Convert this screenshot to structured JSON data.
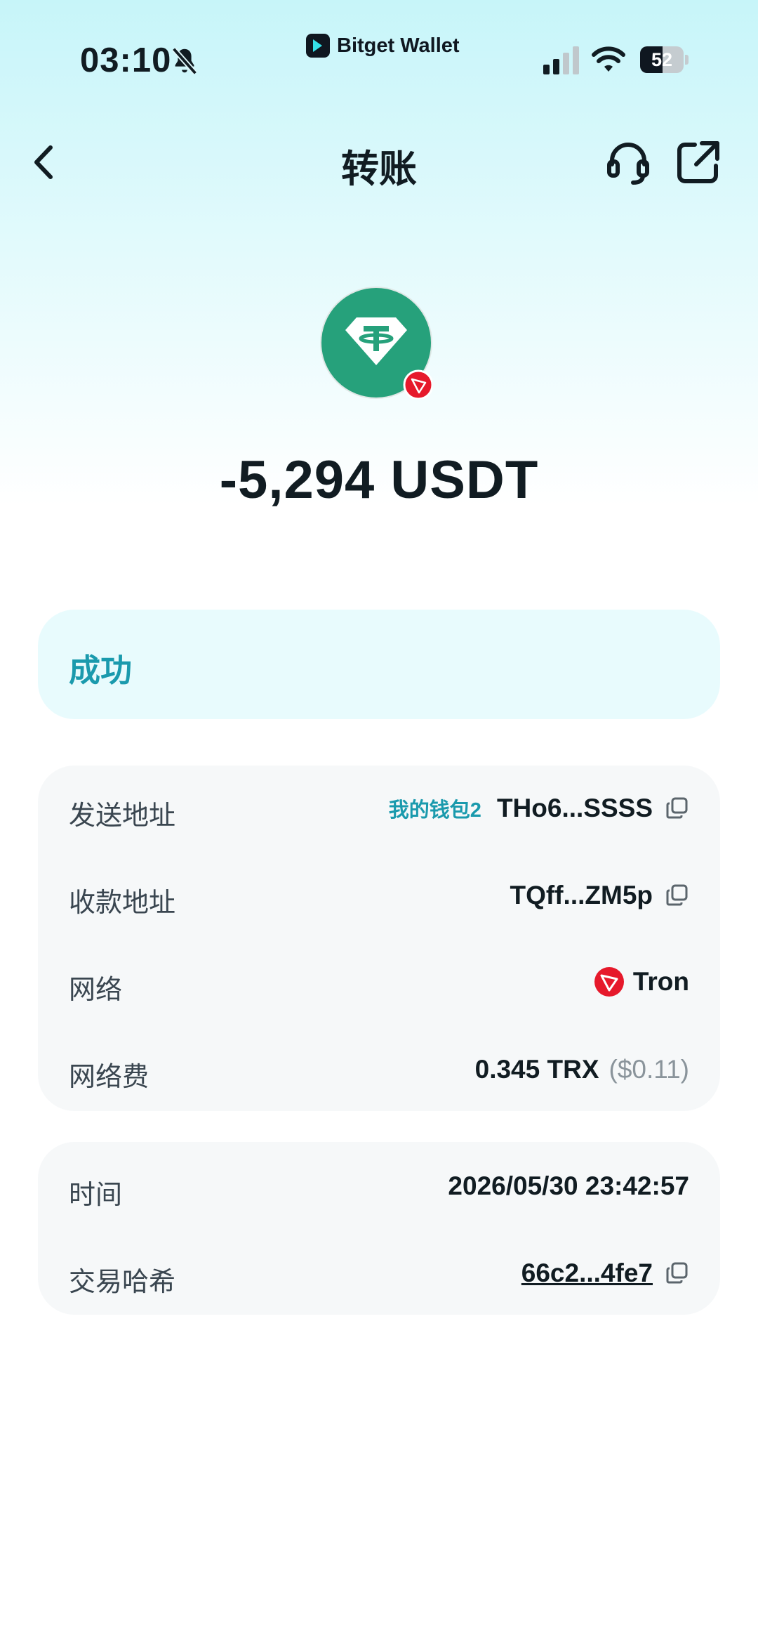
{
  "status_bar": {
    "time": "03:10",
    "brand": "Bitget Wallet",
    "battery": "52",
    "battery_level": 0.52
  },
  "header": {
    "title": "转账"
  },
  "transaction": {
    "amount": "-5,294 USDT",
    "status": "成功"
  },
  "details": {
    "sender_label": "发送地址",
    "sender_wallet_name": "我的钱包2",
    "sender_address": "THo6...SSSS",
    "receiver_label": "收款地址",
    "receiver_address": "TQff...ZM5p",
    "network_label": "网络",
    "network_value": "Tron",
    "fee_label": "网络费",
    "fee_value": "0.345 TRX",
    "fee_usd": "($0.11)"
  },
  "meta": {
    "time_label": "时间",
    "time_value": "2026/05/30 23:42:57",
    "hash_label": "交易哈希",
    "hash_value": "66c2...4fe7"
  },
  "colors": {
    "accent": "#1a9aad",
    "tether_green": "#26a17b",
    "tron_red": "#e6192b",
    "text_dark": "#111c22"
  },
  "icons": {
    "back": "chevron-left-icon",
    "support": "headset-icon",
    "share": "share-icon",
    "copy": "copy-icon",
    "mute": "bell-slash-icon"
  }
}
